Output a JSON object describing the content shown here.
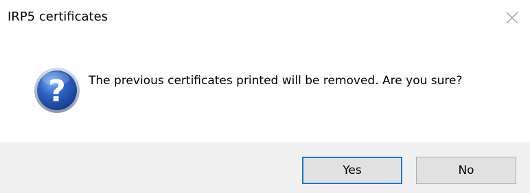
{
  "window": {
    "title": "IRP5 certificates",
    "close_icon": "close-icon"
  },
  "message": {
    "icon": "question-icon",
    "text": "The previous certificates printed will be removed. Are you sure?"
  },
  "buttons": {
    "yes_label": "Yes",
    "no_label": "No",
    "default": "yes"
  },
  "colors": {
    "button_area_bg": "#f0f0f0",
    "button_bg": "#e1e1e1",
    "default_border": "#0078d7",
    "icon_blue": "#1f4fa8"
  }
}
